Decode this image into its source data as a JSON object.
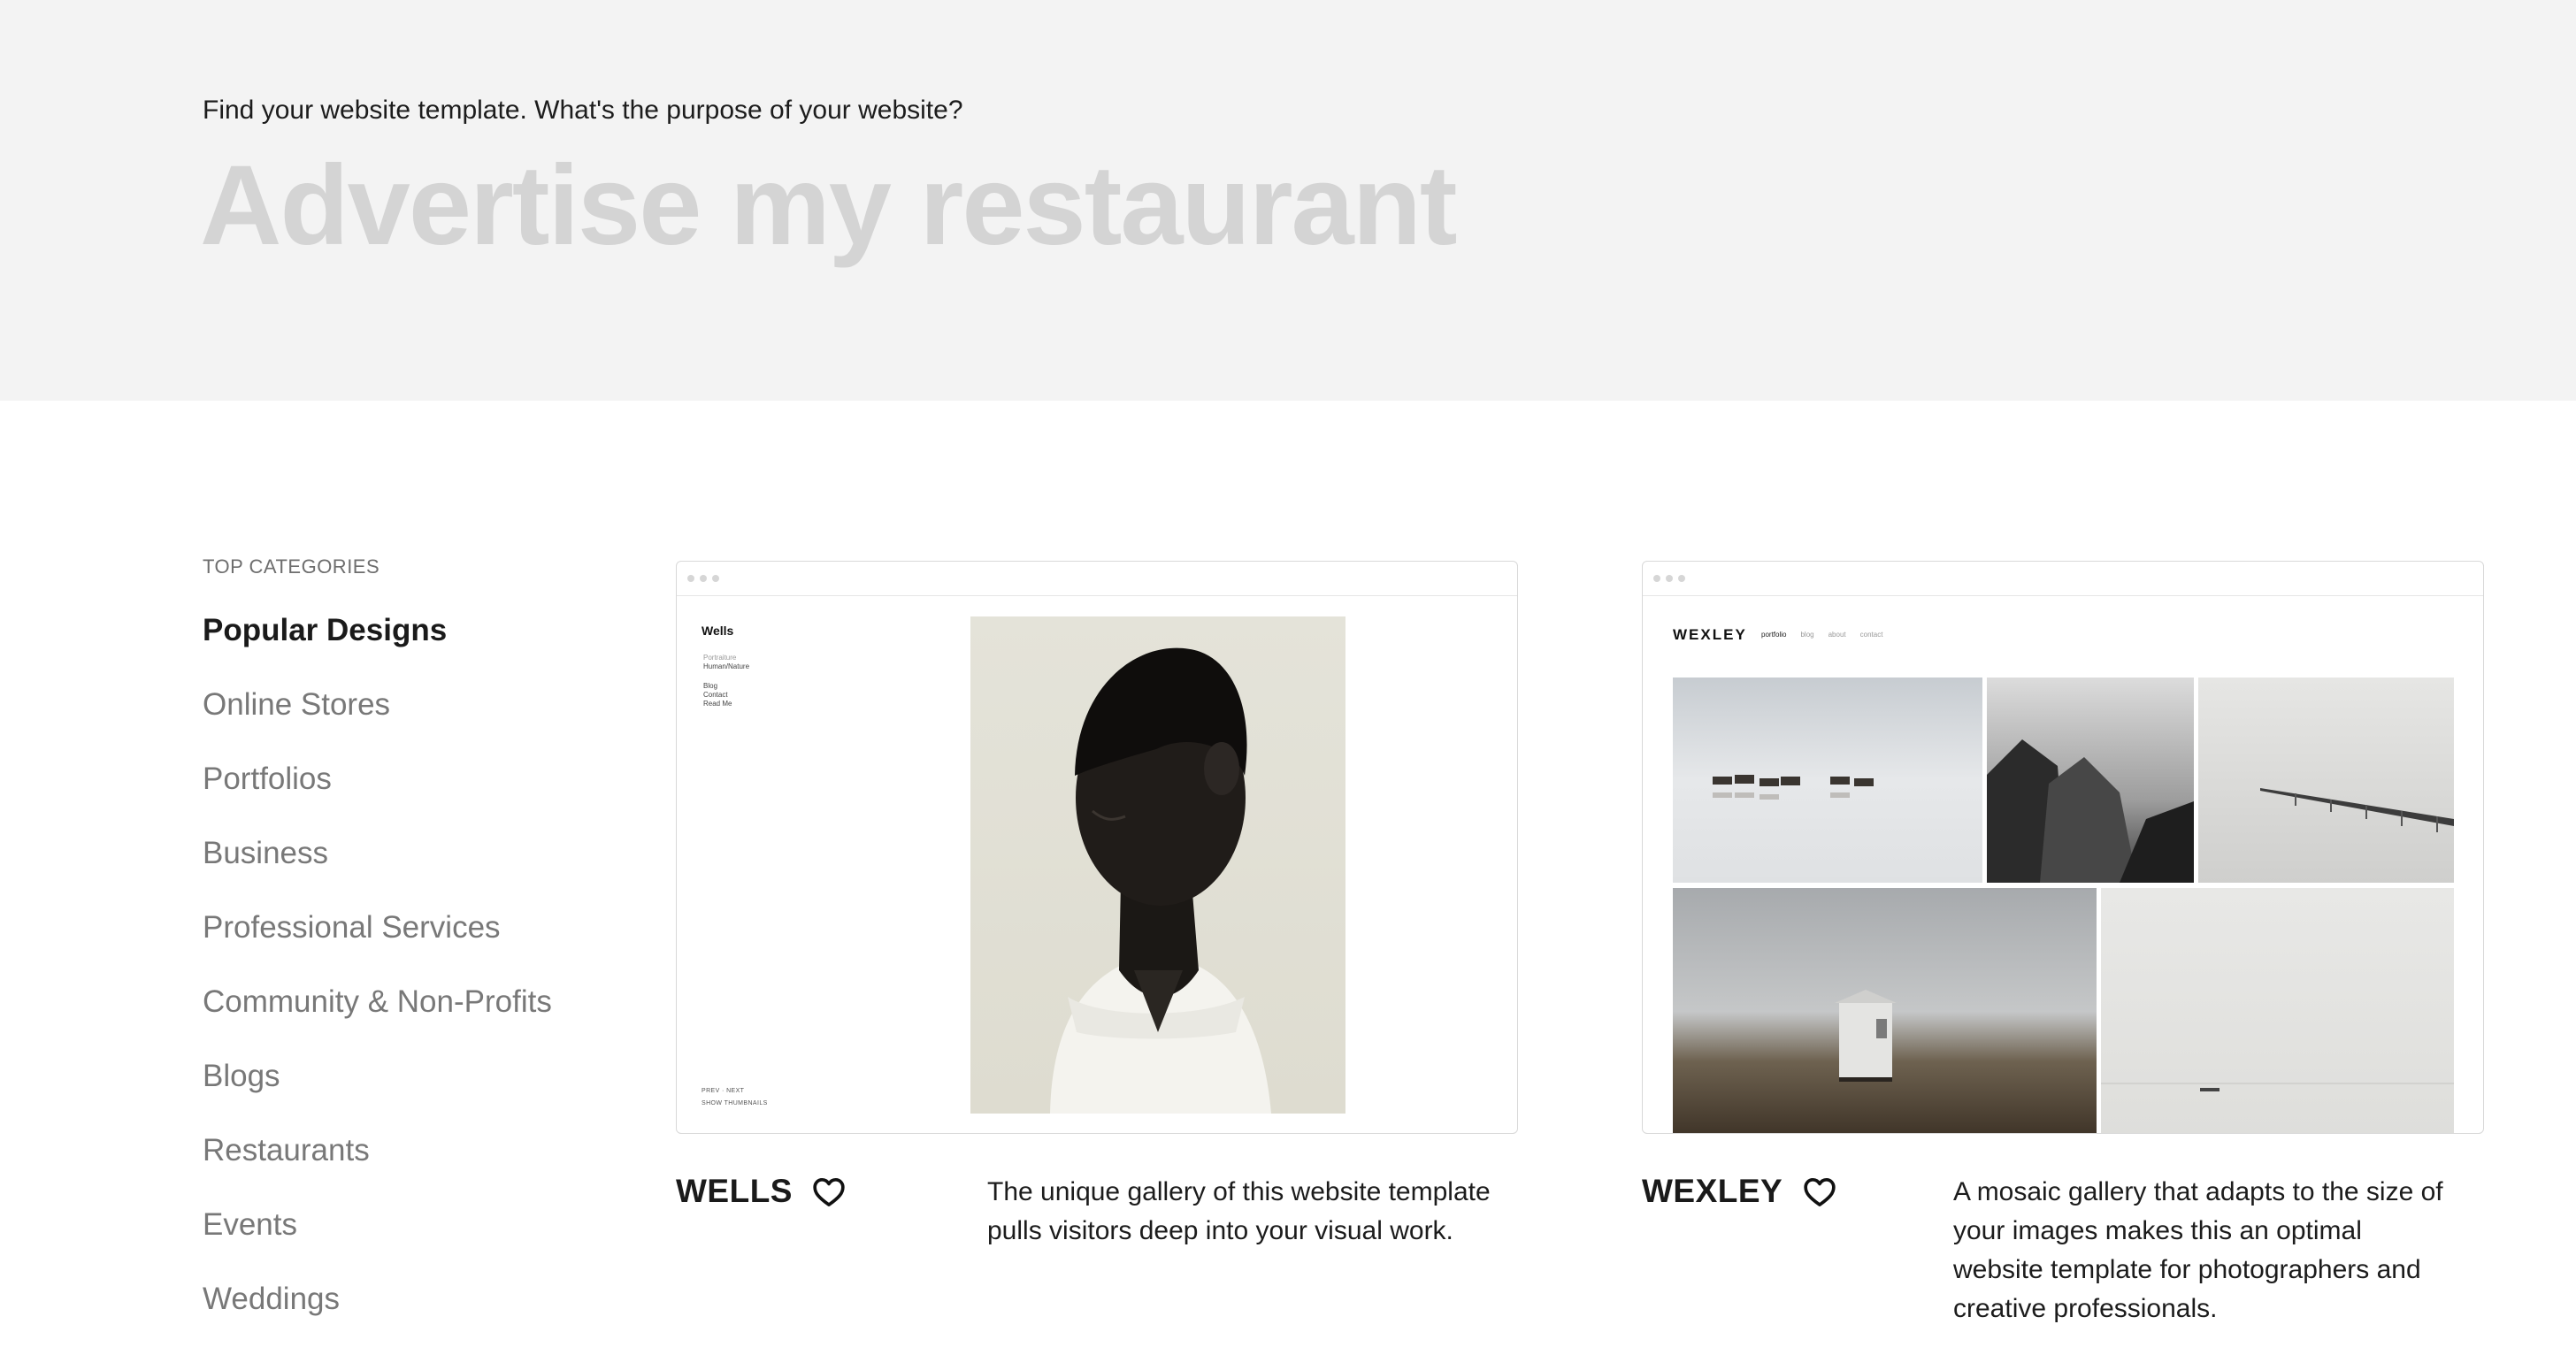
{
  "hero": {
    "prompt": "Find your website template. What's the purpose of your website?",
    "query": "Advertise my restaurant"
  },
  "sidebar": {
    "heading": "TOP CATEGORIES",
    "items": [
      {
        "label": "Popular Designs",
        "active": true
      },
      {
        "label": "Online Stores",
        "active": false
      },
      {
        "label": "Portfolios",
        "active": false
      },
      {
        "label": "Business",
        "active": false
      },
      {
        "label": "Professional Services",
        "active": false
      },
      {
        "label": "Community & Non-Profits",
        "active": false
      },
      {
        "label": "Blogs",
        "active": false
      },
      {
        "label": "Restaurants",
        "active": false
      },
      {
        "label": "Events",
        "active": false
      },
      {
        "label": "Weddings",
        "active": false
      }
    ]
  },
  "templates": [
    {
      "name": "WELLS",
      "description": "The unique gallery of this website template pulls visitors deep into your visual work.",
      "preview": {
        "site_title": "Wells",
        "nav": [
          "Portraiture",
          "Human/Nature",
          "Blog",
          "Contact",
          "Read Me"
        ],
        "footer": [
          "PREV · NEXT",
          "SHOW THUMBNAILS"
        ]
      }
    },
    {
      "name": "WEXLEY",
      "description": "A mosaic gallery that adapts to the size of your images makes this an optimal website template for photographers and creative professionals.",
      "preview": {
        "site_title": "WEXLEY",
        "nav": [
          "portfolio",
          "blog",
          "about",
          "contact"
        ]
      }
    }
  ],
  "icons": {
    "favorite": "heart-outline-icon",
    "window_controls": "window-dots-icon"
  },
  "colors": {
    "hero_bg": "#f3f3f3",
    "query_text": "#d4d4d4",
    "active_category": "#1a1a1a",
    "inactive_category": "#787878"
  }
}
